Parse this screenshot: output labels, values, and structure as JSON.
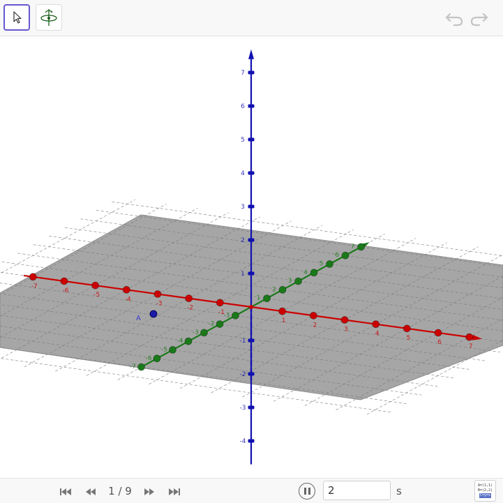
{
  "toolbar": {
    "tools": [
      {
        "name": "move-tool",
        "icon": "pointer-arrow-icon",
        "selected": true
      },
      {
        "name": "rotate-view-tool",
        "icon": "rotate-3d-icon",
        "selected": false
      }
    ],
    "undo_icon": "undo-icon",
    "redo_icon": "redo-icon"
  },
  "graphics_3d": {
    "axes": {
      "x": {
        "color": "#cc0000",
        "ticks": [
          "-7",
          "-6",
          "-5",
          "-4",
          "-3",
          "-2",
          "-1",
          "1",
          "2",
          "3",
          "4",
          "5",
          "6",
          "7"
        ]
      },
      "y": {
        "color": "#1a7a1a",
        "ticks": [
          "-7",
          "-6",
          "-5",
          "-4",
          "-3",
          "-2",
          "-1",
          "1",
          "2",
          "3",
          "4",
          "5",
          "6",
          "7"
        ]
      },
      "z": {
        "color": "#1010b0",
        "ticks": [
          "-4",
          "-3",
          "-2",
          "-1",
          "1",
          "2",
          "3",
          "4",
          "5",
          "6",
          "7"
        ]
      }
    },
    "plane_color": "#a6a6a6",
    "point": {
      "label": "A",
      "color": "#1a1aa8"
    }
  },
  "playback": {
    "first_icon": "skip-to-start-icon",
    "prev_icon": "previous-icon",
    "page_indicator": "1 / 9",
    "next_icon": "next-icon",
    "last_icon": "skip-to-end-icon",
    "pause_icon": "pause-icon",
    "speed_value": "2",
    "speed_unit": "s",
    "algebra_icon": "algebra-view-icon",
    "algebra_lines": [
      "A=(1,1)",
      "B=(2,2)",
      "C=y=x"
    ]
  }
}
